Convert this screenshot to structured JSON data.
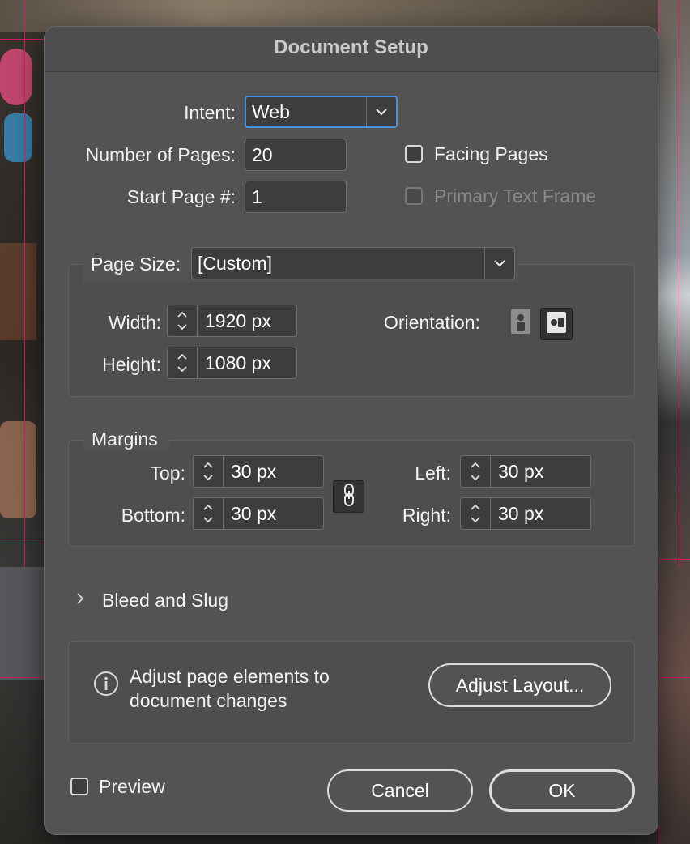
{
  "dialog": {
    "title": "Document Setup"
  },
  "intent": {
    "label": "Intent:",
    "value": "Web"
  },
  "pages": {
    "num_label": "Number of Pages:",
    "num_value": "20",
    "start_label": "Start Page #:",
    "start_value": "1",
    "facing_label": "Facing Pages",
    "facing_checked": false,
    "primary_text_label": "Primary Text Frame",
    "primary_text_checked": false,
    "primary_text_disabled": true
  },
  "page_size": {
    "label": "Page Size:",
    "value": "[Custom]",
    "width_label": "Width:",
    "width_value": "1920 px",
    "height_label": "Height:",
    "height_value": "1080 px",
    "orientation_label": "Orientation:",
    "orientation_selected": "landscape"
  },
  "margins": {
    "legend": "Margins",
    "top_label": "Top:",
    "top_value": "30 px",
    "bottom_label": "Bottom:",
    "bottom_value": "30 px",
    "left_label": "Left:",
    "left_value": "30 px",
    "right_label": "Right:",
    "right_value": "30 px",
    "linked": true
  },
  "bleed": {
    "label": "Bleed and Slug",
    "expanded": false
  },
  "adjust": {
    "text_line1": "Adjust page elements to",
    "text_line2": "document changes",
    "button": "Adjust Layout..."
  },
  "footer": {
    "preview_label": "Preview",
    "preview_checked": false,
    "cancel": "Cancel",
    "ok": "OK"
  },
  "colors": {
    "dialog_bg": "#535353",
    "focus_accent": "#4a8fe0",
    "text": "#f2f2f2",
    "disabled_text": "#8a8a8a"
  },
  "icons": [
    "chevron-down-icon",
    "spinner-arrows-icon",
    "portrait-icon",
    "landscape-icon",
    "chain-link-icon",
    "chevron-right-icon",
    "info-icon"
  ]
}
